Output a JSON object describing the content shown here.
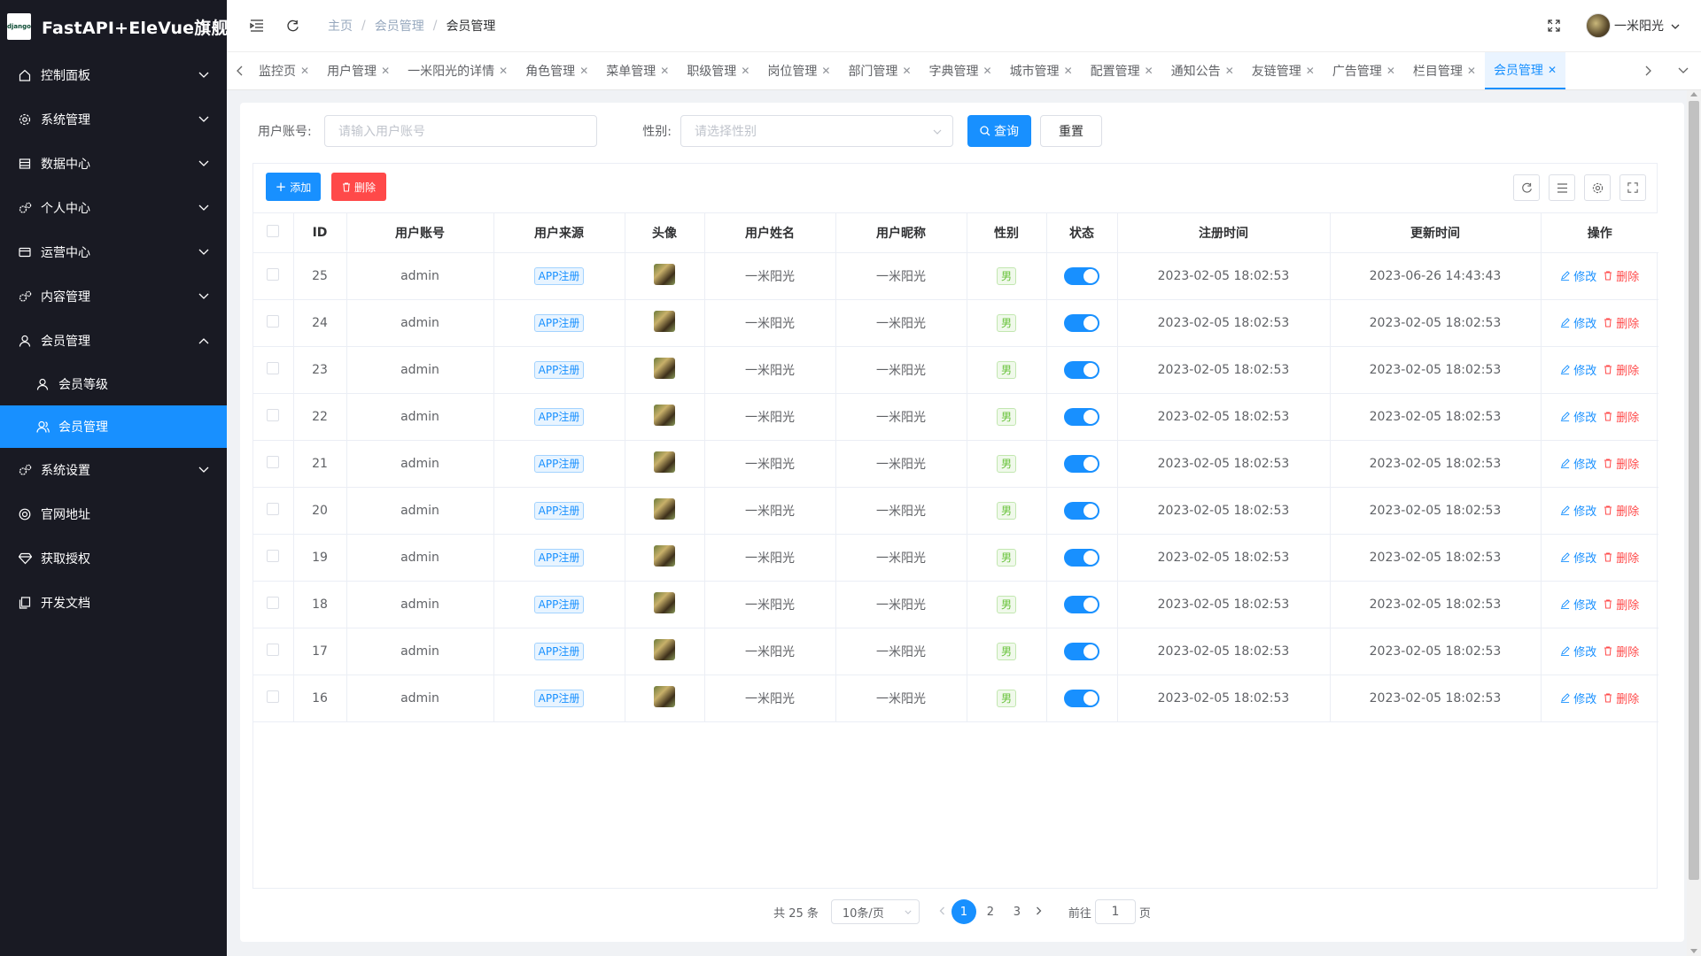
{
  "app": {
    "title": "FastAPI+EleVue旗舰版",
    "logo_text": "django"
  },
  "sidebar": {
    "items": [
      {
        "label": "控制面板",
        "icon": "home-icon",
        "expandable": true
      },
      {
        "label": "系统管理",
        "icon": "gear-icon",
        "expandable": true
      },
      {
        "label": "数据中心",
        "icon": "database-icon",
        "expandable": true
      },
      {
        "label": "个人中心",
        "icon": "gears-icon",
        "expandable": true
      },
      {
        "label": "运营中心",
        "icon": "card-icon",
        "expandable": true
      },
      {
        "label": "内容管理",
        "icon": "gears-icon",
        "expandable": true
      },
      {
        "label": "会员管理",
        "icon": "user-icon",
        "expandable": true,
        "expanded": true
      },
      {
        "label": "会员等级",
        "icon": "user-icon",
        "sub": true
      },
      {
        "label": "会员管理",
        "icon": "users-icon",
        "sub": true,
        "active": true
      },
      {
        "label": "系统设置",
        "icon": "gears-icon",
        "expandable": true
      },
      {
        "label": "官网地址",
        "icon": "globe-icon"
      },
      {
        "label": "获取授权",
        "icon": "diamond-icon"
      },
      {
        "label": "开发文档",
        "icon": "copy-icon"
      }
    ]
  },
  "navbar": {
    "breadcrumb": [
      "主页",
      "会员管理",
      "会员管理"
    ],
    "username": "一米阳光"
  },
  "tabs": [
    {
      "label": "监控页"
    },
    {
      "label": "用户管理"
    },
    {
      "label": "一米阳光的详情"
    },
    {
      "label": "角色管理"
    },
    {
      "label": "菜单管理"
    },
    {
      "label": "职级管理"
    },
    {
      "label": "岗位管理"
    },
    {
      "label": "部门管理"
    },
    {
      "label": "字典管理"
    },
    {
      "label": "城市管理"
    },
    {
      "label": "配置管理"
    },
    {
      "label": "通知公告"
    },
    {
      "label": "友链管理"
    },
    {
      "label": "广告管理"
    },
    {
      "label": "栏目管理"
    },
    {
      "label": "会员管理",
      "active": true
    }
  ],
  "search": {
    "account_label": "用户账号:",
    "account_placeholder": "请输入用户账号",
    "gender_label": "性别:",
    "gender_placeholder": "请选择性别",
    "query_label": "查询",
    "reset_label": "重置"
  },
  "toolbar": {
    "add_label": "添加",
    "delete_label": "删除"
  },
  "table": {
    "headers": [
      "ID",
      "用户账号",
      "用户来源",
      "头像",
      "用户姓名",
      "用户昵称",
      "性别",
      "状态",
      "注册时间",
      "更新时间",
      "操作"
    ],
    "edit_label": "修改",
    "delete_label": "删除",
    "rows": [
      {
        "id": "25",
        "account": "admin",
        "source": "APP注册",
        "name": "一米阳光",
        "nickname": "一米阳光",
        "gender": "男",
        "status": true,
        "created": "2023-02-05 18:02:53",
        "updated": "2023-06-26 14:43:43"
      },
      {
        "id": "24",
        "account": "admin",
        "source": "APP注册",
        "name": "一米阳光",
        "nickname": "一米阳光",
        "gender": "男",
        "status": true,
        "created": "2023-02-05 18:02:53",
        "updated": "2023-02-05 18:02:53"
      },
      {
        "id": "23",
        "account": "admin",
        "source": "APP注册",
        "name": "一米阳光",
        "nickname": "一米阳光",
        "gender": "男",
        "status": true,
        "created": "2023-02-05 18:02:53",
        "updated": "2023-02-05 18:02:53"
      },
      {
        "id": "22",
        "account": "admin",
        "source": "APP注册",
        "name": "一米阳光",
        "nickname": "一米阳光",
        "gender": "男",
        "status": true,
        "created": "2023-02-05 18:02:53",
        "updated": "2023-02-05 18:02:53"
      },
      {
        "id": "21",
        "account": "admin",
        "source": "APP注册",
        "name": "一米阳光",
        "nickname": "一米阳光",
        "gender": "男",
        "status": true,
        "created": "2023-02-05 18:02:53",
        "updated": "2023-02-05 18:02:53"
      },
      {
        "id": "20",
        "account": "admin",
        "source": "APP注册",
        "name": "一米阳光",
        "nickname": "一米阳光",
        "gender": "男",
        "status": true,
        "created": "2023-02-05 18:02:53",
        "updated": "2023-02-05 18:02:53"
      },
      {
        "id": "19",
        "account": "admin",
        "source": "APP注册",
        "name": "一米阳光",
        "nickname": "一米阳光",
        "gender": "男",
        "status": true,
        "created": "2023-02-05 18:02:53",
        "updated": "2023-02-05 18:02:53"
      },
      {
        "id": "18",
        "account": "admin",
        "source": "APP注册",
        "name": "一米阳光",
        "nickname": "一米阳光",
        "gender": "男",
        "status": true,
        "created": "2023-02-05 18:02:53",
        "updated": "2023-02-05 18:02:53"
      },
      {
        "id": "17",
        "account": "admin",
        "source": "APP注册",
        "name": "一米阳光",
        "nickname": "一米阳光",
        "gender": "男",
        "status": true,
        "created": "2023-02-05 18:02:53",
        "updated": "2023-02-05 18:02:53"
      },
      {
        "id": "16",
        "account": "admin",
        "source": "APP注册",
        "name": "一米阳光",
        "nickname": "一米阳光",
        "gender": "男",
        "status": true,
        "created": "2023-02-05 18:02:53",
        "updated": "2023-02-05 18:02:53"
      }
    ]
  },
  "pagination": {
    "total_text": "共 25 条",
    "page_size": "10条/页",
    "pages": [
      "1",
      "2",
      "3"
    ],
    "current": "1",
    "goto_label": "前往",
    "goto_value": "1",
    "goto_suffix": "页"
  },
  "colors": {
    "primary": "#1890ff",
    "danger": "#ff4949",
    "sidebar_bg": "#191a23",
    "success": "#67c23a"
  }
}
